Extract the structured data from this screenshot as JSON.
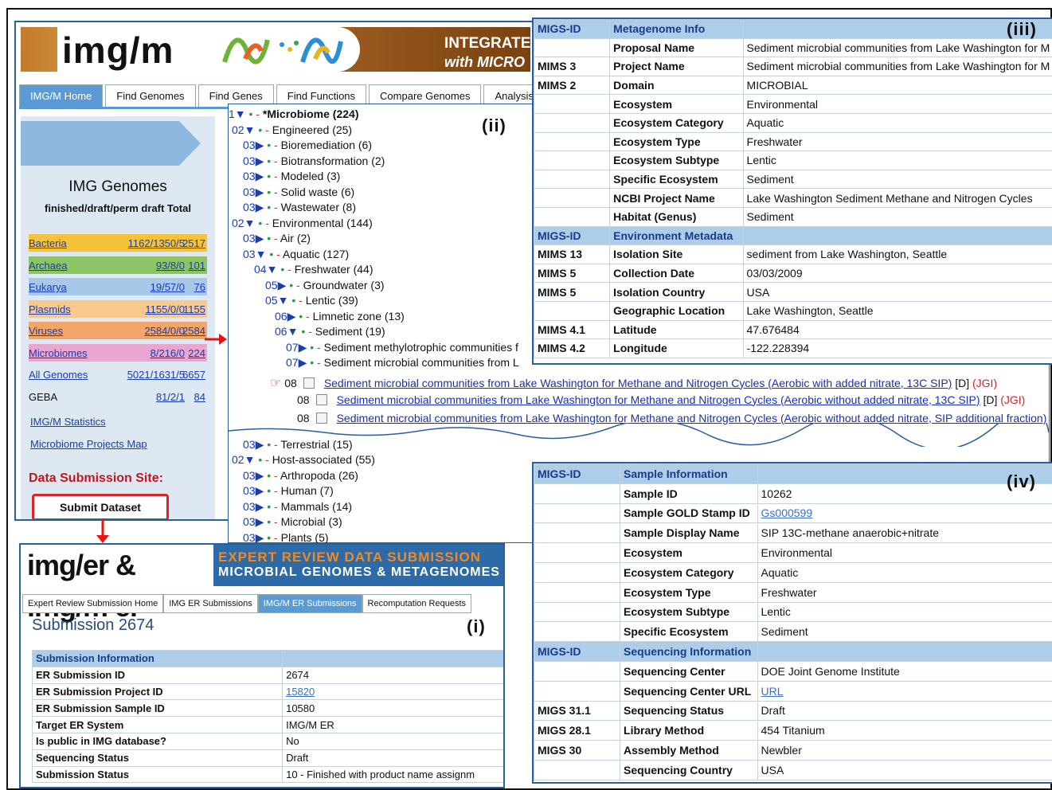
{
  "imgm": {
    "brand": "img/m",
    "banner_right_1": "INTEGRATE",
    "banner_right_2": "with MICRO",
    "tabs": [
      "IMG/M Home",
      "Find Genomes",
      "Find Genes",
      "Find Functions",
      "Compare Genomes",
      "Analysis"
    ],
    "img_genomes_title": "IMG Genomes",
    "img_genomes_header": "finished/draft/perm draft Total",
    "genome_rows": [
      {
        "name": "Bacteria",
        "counts": "1162/1350/5",
        "total": "2517",
        "color": "#f5c23a"
      },
      {
        "name": "Archaea",
        "counts": "93/8/0",
        "total": "101",
        "color": "#8cc466"
      },
      {
        "name": "Eukarya",
        "counts": "19/57/0",
        "total": "76",
        "color": "#a9c7e8"
      },
      {
        "name": "Plasmids",
        "counts": "1155/0/0",
        "total": "1155",
        "color": "#f7c98c"
      },
      {
        "name": "Viruses",
        "counts": "2584/0/0",
        "total": "2584",
        "color": "#f2a66a"
      },
      {
        "name": "Microbiomes",
        "counts": "8/216/0",
        "total": "224",
        "color": "#e9a6cf"
      },
      {
        "name": "All Genomes",
        "counts": "5021/1631/5",
        "total": "6657",
        "color": "#dde8f2"
      },
      {
        "name": "GEBA",
        "counts": "81/2/1",
        "total": "84",
        "color": "#dde8f2"
      }
    ],
    "stats_link": "IMG/M Statistics",
    "map_link": "Microbiome Projects Map",
    "data_submission_site": "Data Submission Site:",
    "submit_button": "Submit Dataset"
  },
  "tree": {
    "label": "(ii)",
    "lines": [
      {
        "lv": "1",
        "arrow": "▼",
        "text": "*Microbiome (224)",
        "bold": true
      },
      {
        "lv": "02",
        "arrow": "▼",
        "text": "Engineered (25)"
      },
      {
        "lv": "03",
        "arrow": "▶",
        "text": "Bioremediation (6)"
      },
      {
        "lv": "03",
        "arrow": "▶",
        "text": "Biotransformation (2)"
      },
      {
        "lv": "03",
        "arrow": "▶",
        "text": "Modeled (3)"
      },
      {
        "lv": "03",
        "arrow": "▶",
        "text": "Solid waste (6)"
      },
      {
        "lv": "03",
        "arrow": "▶",
        "text": "Wastewater (8)"
      },
      {
        "lv": "02",
        "arrow": "▼",
        "text": "Environmental (144)"
      },
      {
        "lv": "03",
        "arrow": "▶",
        "text": "Air (2)"
      },
      {
        "lv": "03",
        "arrow": "▼",
        "text": "Aquatic (127)"
      },
      {
        "lv": "04",
        "arrow": "▼",
        "text": "Freshwater (44)"
      },
      {
        "lv": "05",
        "arrow": "▶",
        "text": "Groundwater (3)"
      },
      {
        "lv": "05",
        "arrow": "▼",
        "text": "Lentic (39)"
      },
      {
        "lv": "06",
        "arrow": "▶",
        "text": "Limnetic zone (13)"
      },
      {
        "lv": "06",
        "arrow": "▼",
        "text": "Sediment (19)"
      },
      {
        "lv": "07",
        "arrow": "▶",
        "text": "Sediment methylotrophic communities f"
      },
      {
        "lv": "07",
        "arrow": "▶",
        "text": "Sediment microbial communities from L"
      }
    ],
    "leaves": [
      {
        "lv": "08",
        "text": "Sediment microbial communities from Lake Washington for Methane and Nitrogen Cycles (Aerobic with added nitrate, 13C SIP)",
        "suffix": "[D]",
        "jgi": "(JGI)"
      },
      {
        "lv": "08",
        "text": "Sediment microbial communities from Lake Washington for Methane and Nitrogen Cycles (Aerobic without added nitrate, 13C SIP)",
        "suffix": "[D]",
        "jgi": "(JGI)"
      },
      {
        "lv": "08",
        "text": "Sediment microbial communities from Lake Washington for Methane and Nitrogen Cycles (Aerobic without added nitrate, SIP additional fraction)",
        "suffix": "",
        "jgi": ""
      }
    ],
    "tail": [
      {
        "lv": "03",
        "arrow": "▶",
        "text": "Terrestrial (15)"
      },
      {
        "lv": "02",
        "arrow": "▼",
        "text": "Host-associated (55)"
      },
      {
        "lv": "03",
        "arrow": "▶",
        "text": "Arthropoda (26)"
      },
      {
        "lv": "03",
        "arrow": "▶",
        "text": "Human (7)"
      },
      {
        "lv": "03",
        "arrow": "▶",
        "text": "Mammals (14)"
      },
      {
        "lv": "03",
        "arrow": "▶",
        "text": "Microbial (3)"
      },
      {
        "lv": "03",
        "arrow": "▶",
        "text": "Plants (5)"
      }
    ]
  },
  "metagenome": {
    "label": "(iii)",
    "rows": [
      {
        "h": true,
        "a": "MIGS-ID",
        "b": "Metagenome Info",
        "c": ""
      },
      {
        "a": "",
        "b": "Proposal Name",
        "c": "Sediment microbial communities from Lake Washington for M"
      },
      {
        "a": "MIMS 3",
        "b": "Project Name",
        "c": "Sediment microbial communities from Lake Washington for M"
      },
      {
        "a": "MIMS 2",
        "b": "Domain",
        "c": "MICROBIAL"
      },
      {
        "a": "",
        "b": "Ecosystem",
        "c": "Environmental"
      },
      {
        "a": "",
        "b": "Ecosystem Category",
        "c": "Aquatic"
      },
      {
        "a": "",
        "b": "Ecosystem Type",
        "c": "Freshwater"
      },
      {
        "a": "",
        "b": "Ecosystem Subtype",
        "c": "Lentic"
      },
      {
        "a": "",
        "b": "Specific Ecosystem",
        "c": "Sediment"
      },
      {
        "a": "",
        "b": "NCBI Project Name",
        "c": "Lake Washington Sediment Methane and Nitrogen Cycles"
      },
      {
        "a": "",
        "b": "Habitat (Genus)",
        "c": "Sediment"
      },
      {
        "h": true,
        "a": "MIGS-ID",
        "b": "Environment Metadata",
        "c": ""
      },
      {
        "a": "MIMS 13",
        "b": "Isolation Site",
        "c": "sediment from Lake Washington, Seattle"
      },
      {
        "a": "MIMS 5",
        "b": "Collection Date",
        "c": "03/03/2009"
      },
      {
        "a": "MIMS 5",
        "b": "Isolation Country",
        "c": "USA"
      },
      {
        "a": "",
        "b": "Geographic Location",
        "c": "Lake Washington, Seattle"
      },
      {
        "a": "MIMS 4.1",
        "b": "Latitude",
        "c": "47.676484"
      },
      {
        "a": "MIMS 4.2",
        "b": "Longitude",
        "c": "-122.228394"
      }
    ]
  },
  "sample": {
    "label": "(iv)",
    "rows": [
      {
        "h": true,
        "a": "MIGS-ID",
        "b": "Sample Information",
        "c": ""
      },
      {
        "a": "",
        "b": "Sample ID",
        "c": "10262"
      },
      {
        "a": "",
        "b": "Sample GOLD Stamp ID",
        "c": "Gs000599",
        "link": true
      },
      {
        "a": "",
        "b": "Sample Display Name",
        "c": "SIP 13C-methane anaerobic+nitrate"
      },
      {
        "a": "",
        "b": "Ecosystem",
        "c": "Environmental"
      },
      {
        "a": "",
        "b": "Ecosystem Category",
        "c": "Aquatic"
      },
      {
        "a": "",
        "b": "Ecosystem Type",
        "c": "Freshwater"
      },
      {
        "a": "",
        "b": "Ecosystem Subtype",
        "c": "Lentic"
      },
      {
        "a": "",
        "b": "Specific Ecosystem",
        "c": "Sediment"
      },
      {
        "h": true,
        "a": "MIGS-ID",
        "b": "Sequencing Information",
        "c": ""
      },
      {
        "a": "",
        "b": "Sequencing Center",
        "c": "DOE Joint Genome Institute"
      },
      {
        "a": "",
        "b": "Sequencing Center URL",
        "c": "URL",
        "link": true
      },
      {
        "a": "MIGS 31.1",
        "b": "Sequencing Status",
        "c": "Draft"
      },
      {
        "a": "MIGS 28.1",
        "b": "Library Method",
        "c": "454 Titanium"
      },
      {
        "a": "MIGS 30",
        "b": "Assembly Method",
        "c": "Newbler"
      },
      {
        "a": "",
        "b": "Sequencing Country",
        "c": "USA"
      }
    ]
  },
  "submission": {
    "label": "(i)",
    "brand": "img/er & img/m er",
    "banner_a": "EXPERT REVIEW DATA SUBMISSION",
    "banner_b": "MICROBIAL GENOMES & METAGENOMES",
    "tabs": [
      "Expert Review Submission Home",
      "IMG ER Submissions",
      "IMG/M ER Submissions",
      "Recomputation Requests"
    ],
    "title": "Submission 2674",
    "rows": [
      {
        "h": true,
        "a": "Submission Information",
        "b": ""
      },
      {
        "a": "ER Submission ID",
        "b": "2674"
      },
      {
        "a": "ER Submission Project ID",
        "b": "15820",
        "link": true
      },
      {
        "a": "ER Submission Sample ID",
        "b": "10580"
      },
      {
        "a": "Target ER System",
        "b": "IMG/M ER"
      },
      {
        "a": "Is public in IMG database?",
        "b": "No"
      },
      {
        "a": "Sequencing Status",
        "b": "Draft"
      },
      {
        "a": "Submission Status",
        "b": "10 - Finished with product name assignm"
      }
    ]
  }
}
